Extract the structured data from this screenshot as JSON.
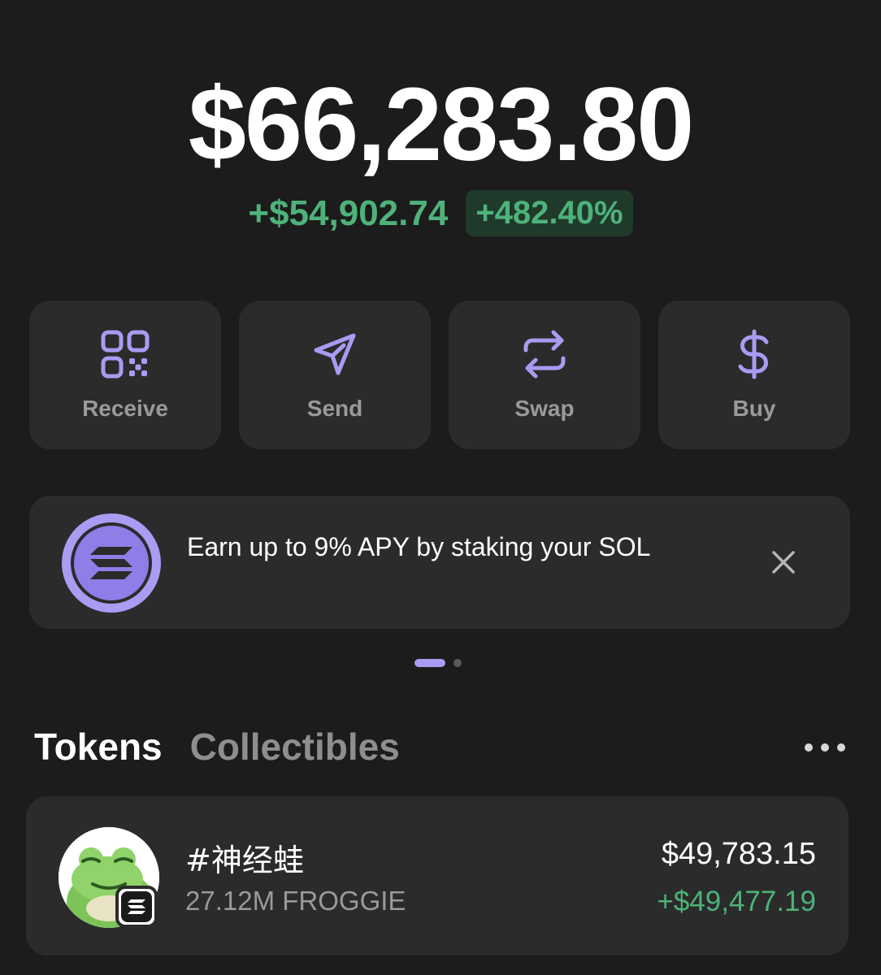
{
  "portfolio": {
    "balance": "$66,283.80",
    "change_value": "+$54,902.74",
    "change_percent": "+482.40%"
  },
  "actions": [
    {
      "label": "Receive",
      "icon": "qr-code-icon"
    },
    {
      "label": "Send",
      "icon": "send-icon"
    },
    {
      "label": "Swap",
      "icon": "swap-icon"
    },
    {
      "label": "Buy",
      "icon": "dollar-icon"
    }
  ],
  "banner": {
    "text": "Earn up to 9% APY by staking your SOL",
    "icon": "solana-icon",
    "close_icon": "close-icon"
  },
  "pagination": {
    "total": 2,
    "active": 1
  },
  "tabs": [
    {
      "label": "Tokens",
      "active": true
    },
    {
      "label": "Collectibles",
      "active": false
    }
  ],
  "tokens": [
    {
      "name": "#神经蛙",
      "amount": "27.12M FROGGIE",
      "value": "$49,783.15",
      "change": "+$49,477.19",
      "icon": "frog-avatar",
      "chain_icon": "solana-icon"
    }
  ],
  "colors": {
    "background": "#1c1c1c",
    "card": "#2b2b2b",
    "accent": "#a99bf2",
    "positive": "#4eb27a",
    "muted": "#9a9a9a"
  }
}
